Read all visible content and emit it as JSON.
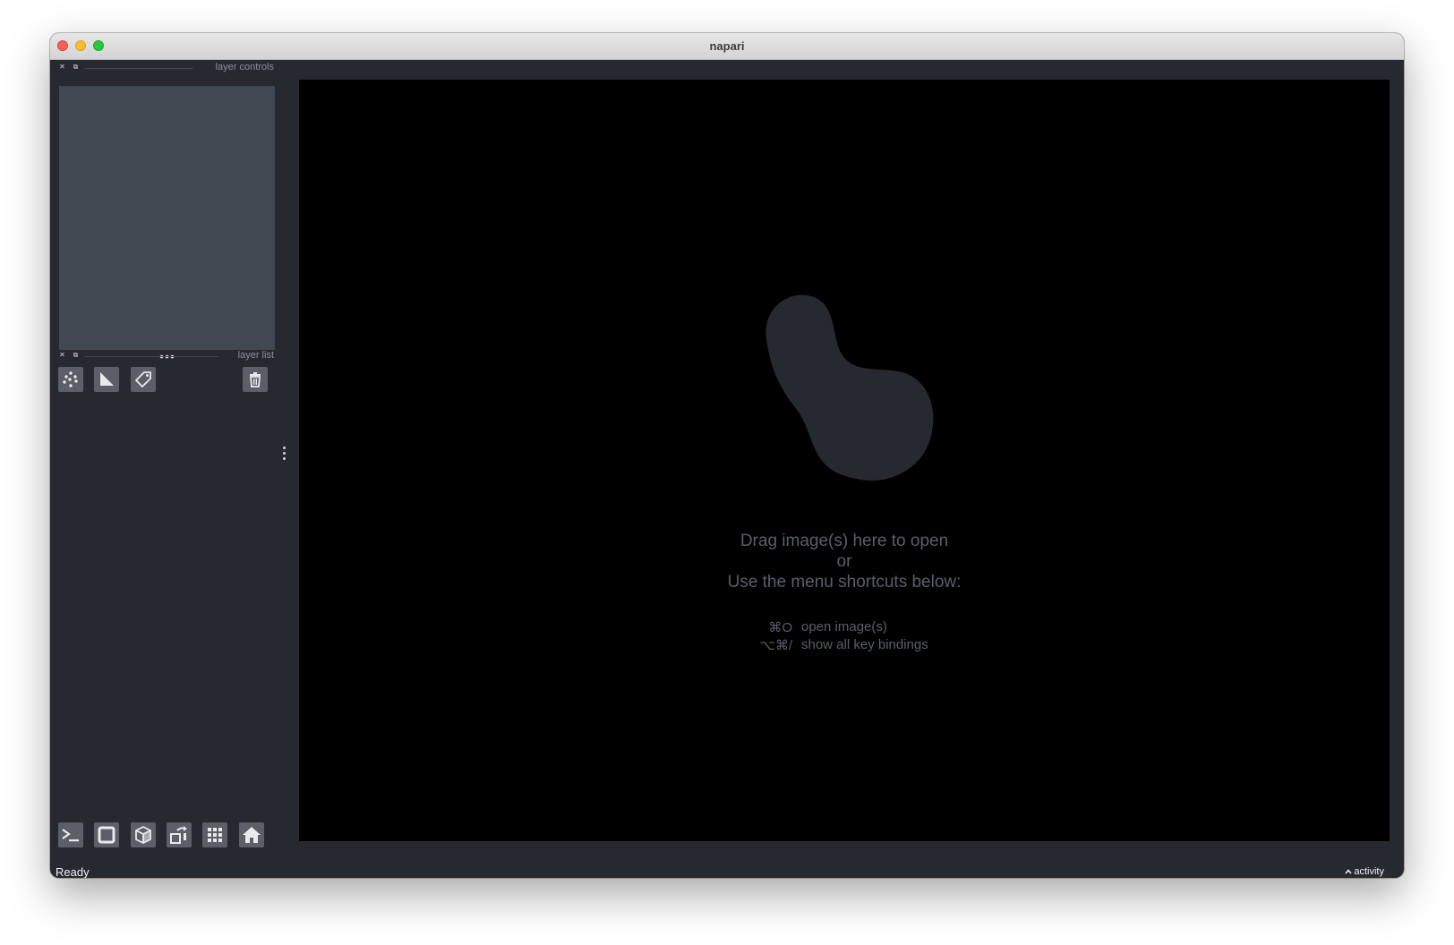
{
  "window": {
    "title": "napari"
  },
  "dock": {
    "layer_controls": {
      "title": "layer controls",
      "float_icon": "float-icon",
      "close_icon": "close-icon"
    },
    "layer_list": {
      "title": "layer list",
      "float_icon": "float-icon",
      "close_icon": "close-icon",
      "buttons": [
        {
          "name": "new-points-layer-button",
          "icon": "points-icon"
        },
        {
          "name": "new-shapes-layer-button",
          "icon": "shapes-icon"
        },
        {
          "name": "new-labels-layer-button",
          "icon": "labels-icon"
        }
      ],
      "delete_button": {
        "icon": "trash-icon"
      }
    }
  },
  "viewer_buttons": [
    {
      "name": "console-button",
      "icon": "console-icon"
    },
    {
      "name": "2d-3d-toggle-button",
      "icon": "square-icon"
    },
    {
      "name": "ndisplay-button",
      "icon": "cube-icon"
    },
    {
      "name": "roll-dims-button",
      "icon": "roll-icon"
    },
    {
      "name": "grid-view-button",
      "icon": "grid-icon"
    },
    {
      "name": "reset-view-button",
      "icon": "home-icon"
    }
  ],
  "canvas": {
    "welcome": {
      "line1": "Drag image(s) here to open",
      "line2": "or",
      "line3": "Use the menu shortcuts below:",
      "shortcuts": [
        {
          "key": "⌘O",
          "desc": "open image(s)"
        },
        {
          "key": "⌥⌘/",
          "desc": "show all key bindings"
        }
      ]
    }
  },
  "status_bar": {
    "status": "Ready",
    "activity": "activity"
  },
  "colors": {
    "background": "#262930",
    "panel": "#414851",
    "button": "#5a5f68",
    "canvas": "#000000",
    "text_muted": "#5a5f68"
  }
}
